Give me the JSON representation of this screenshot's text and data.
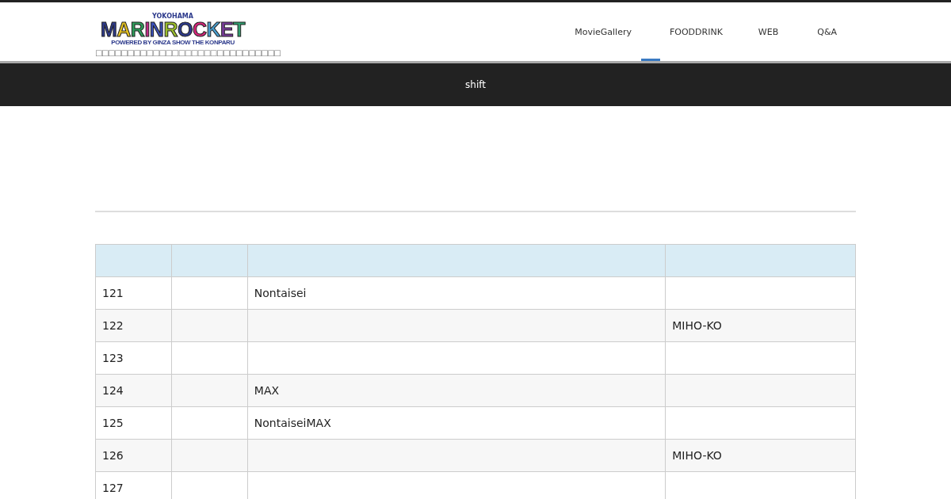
{
  "header": {
    "logo": {
      "top": "YOKOHAMA",
      "main": "MARINROCKET",
      "sub": "POWERED BY GINZA SHOW THE KONPARU"
    },
    "tagline": "□□□□□□□□□□□□□□□□□□□□□□□□□□□□□",
    "nav": [
      {
        "label": "MovieGallery",
        "selected": false
      },
      {
        "selected": true
      },
      {
        "label": "FOODDRINK",
        "selected": false
      },
      {
        "label": "WEB",
        "selected": false
      },
      {
        "label": "Q&A",
        "selected": false
      }
    ]
  },
  "page_title": "shift",
  "table": {
    "rows": [
      {
        "column_1": "121",
        "column_3": "Nontaisei"
      },
      {
        "column_1": "122",
        "column_4": "MIHO-KO"
      },
      {
        "column_1": "123"
      },
      {
        "column_1": "124",
        "column_3": "MAX"
      },
      {
        "column_1": "125",
        "column_3": "NontaiseiMAX"
      },
      {
        "column_1": "126",
        "column_4": "MIHO-KO"
      },
      {
        "column_1": "127"
      }
    ]
  }
}
